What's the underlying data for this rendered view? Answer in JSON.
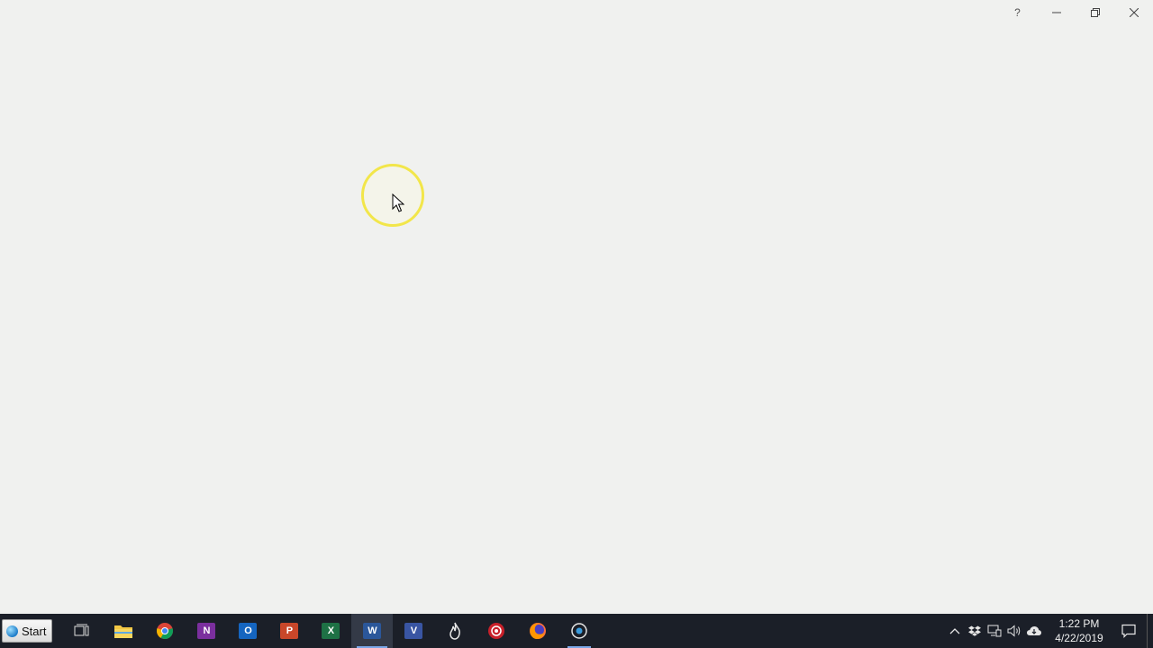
{
  "window": {
    "help_label": "?"
  },
  "taskbar": {
    "start_label": "Start",
    "apps": [
      {
        "id": "task-view",
        "icon": "task-view-icon"
      },
      {
        "id": "file-explorer",
        "icon": "folder-icon"
      },
      {
        "id": "chrome",
        "icon": "chrome-icon"
      },
      {
        "id": "onenote",
        "icon": "onenote-icon",
        "letter": "N",
        "color": "#7b2f9e"
      },
      {
        "id": "outlook",
        "icon": "outlook-icon",
        "letter": "O",
        "color": "#1565c0"
      },
      {
        "id": "powerpoint",
        "icon": "powerpoint-icon",
        "letter": "P",
        "color": "#c9472a"
      },
      {
        "id": "excel",
        "icon": "excel-icon",
        "letter": "X",
        "color": "#1e7145"
      },
      {
        "id": "word",
        "icon": "word-icon",
        "letter": "W",
        "color": "#2b579a",
        "active": true
      },
      {
        "id": "visio",
        "icon": "visio-icon",
        "letter": "V",
        "color": "#3955a3"
      },
      {
        "id": "flame-app",
        "icon": "flame-icon"
      },
      {
        "id": "red-app",
        "icon": "red-badge-icon"
      },
      {
        "id": "firefox",
        "icon": "firefox-icon"
      },
      {
        "id": "recorder",
        "icon": "recorder-icon",
        "running": true
      }
    ],
    "tray": {
      "icons": [
        "chevron-up-icon",
        "dropbox-icon",
        "network-icon",
        "volume-icon",
        "onedrive-icon"
      ],
      "time": "1:22 PM",
      "date": "4/22/2019"
    }
  },
  "colors": {
    "taskbar_bg": "#1b1f28",
    "highlight_ring": "#f2e64a",
    "window_bg": "#f0f1ef"
  }
}
